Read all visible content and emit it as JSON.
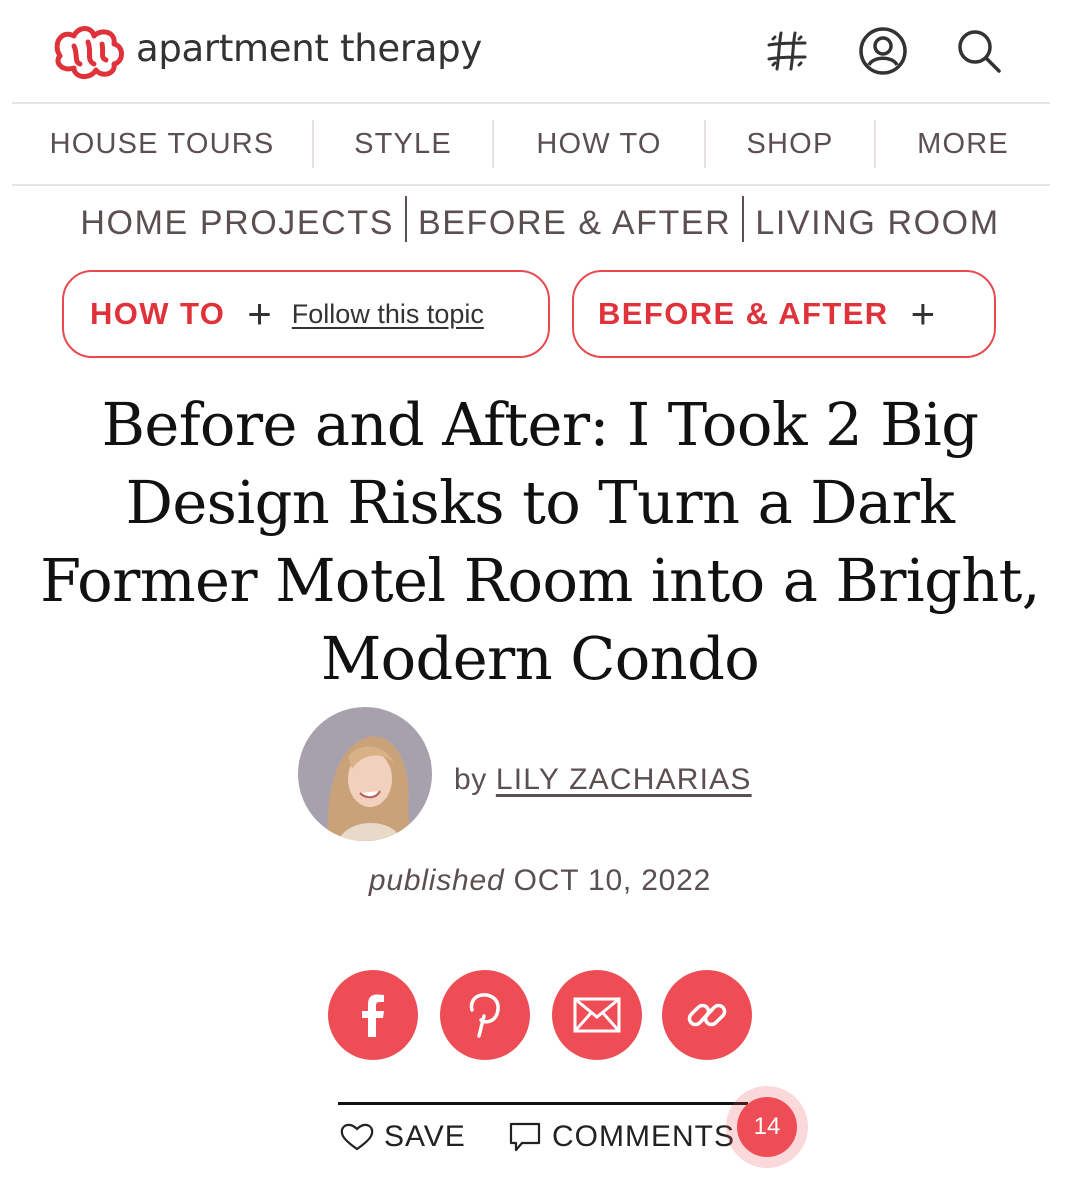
{
  "brand": {
    "name": "apartment therapy",
    "accent_color": "#e0323a"
  },
  "header": {
    "icons": [
      "hashtag-icon",
      "user-account-icon",
      "search-icon"
    ]
  },
  "nav": {
    "items": [
      "HOUSE TOURS",
      "STYLE",
      "HOW TO",
      "SHOP",
      "MORE"
    ]
  },
  "breadcrumb": [
    "HOME PROJECTS",
    "BEFORE & AFTER",
    "LIVING ROOM"
  ],
  "topics": [
    {
      "label": "HOW TO",
      "follow_text": "Follow this topic"
    },
    {
      "label": "BEFORE & AFTER"
    }
  ],
  "article": {
    "title": "Before and After: I Took 2 Big Design Risks to Turn a Dark Former Motel Room into a Bright, Modern Condo",
    "byline_prefix": "by",
    "author": "LILY ZACHARIAS",
    "published_label": "published",
    "published_date": "OCT 10, 2022"
  },
  "share": {
    "icons": [
      "facebook-icon",
      "pinterest-icon",
      "email-icon",
      "link-icon"
    ]
  },
  "actions": {
    "save_label": "SAVE",
    "comments_label": "COMMENTS",
    "comments_count": "14"
  }
}
